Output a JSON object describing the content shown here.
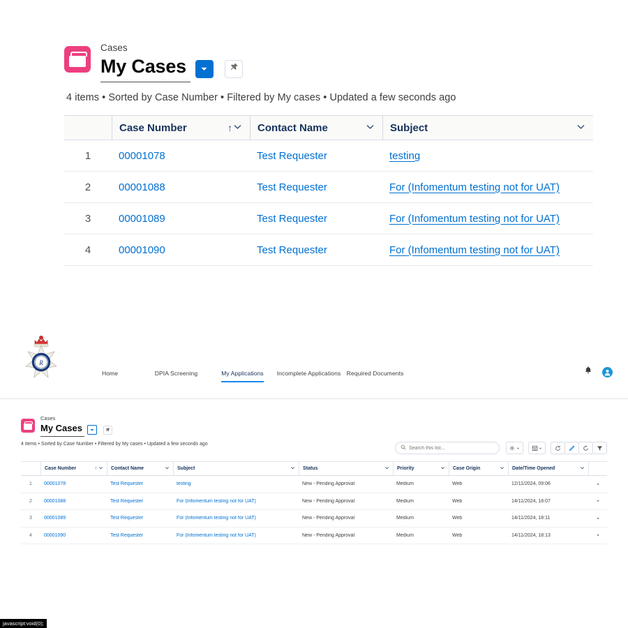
{
  "top": {
    "entity_label": "Cases",
    "view_title": "My Cases",
    "subtitle": "4 items • Sorted by Case Number • Filtered by My cases • Updated a few seconds ago",
    "icons": {
      "entity": "briefcase-icon",
      "view_dropdown": "chevron-down-icon",
      "pin": "pin-icon"
    },
    "columns": [
      "",
      "Case Number",
      "Contact Name",
      "Subject"
    ],
    "sort_indicator": "↑",
    "rows": [
      {
        "num": "1",
        "case_number": "00001078",
        "contact_name": "Test Requester",
        "subject": "testing"
      },
      {
        "num": "2",
        "case_number": "00001088",
        "contact_name": "Test Requester",
        "subject": "For (Infomentum testing not for UAT)"
      },
      {
        "num": "3",
        "case_number": "00001089",
        "contact_name": "Test Requester",
        "subject": "For (Infomentum testing not for UAT)"
      },
      {
        "num": "4",
        "case_number": "00001090",
        "contact_name": "Test Requester",
        "subject": "For (Infomentum testing not for UAT)"
      }
    ]
  },
  "nav": {
    "logo": "police-badge-logo",
    "items": [
      {
        "label": "Home",
        "active": false
      },
      {
        "label": "DPIA Screening",
        "active": false
      },
      {
        "label": "My Applications",
        "active": true
      },
      {
        "label": "Incomplete Applications",
        "active": false
      },
      {
        "label": "Required Documents",
        "active": false
      }
    ],
    "right_icons": [
      {
        "name": "notifications-bell-icon"
      },
      {
        "name": "user-avatar-icon"
      }
    ]
  },
  "lower": {
    "entity_label": "Cases",
    "view_title": "My Cases",
    "subtitle": "4 items • Sorted by Case Number • Filtered by My cases • Updated a few seconds ago",
    "search": {
      "placeholder": "Search this list...",
      "value": ""
    },
    "toolbar_icons": [
      {
        "name": "list-view-controls-icon"
      },
      {
        "name": "display-as-table-icon"
      },
      {
        "name": "refresh-icon"
      },
      {
        "name": "edit-pencil-icon"
      },
      {
        "name": "chart-refresh-icon"
      },
      {
        "name": "filter-icon"
      }
    ],
    "columns": [
      "",
      "Case Number",
      "Contact Name",
      "Subject",
      "Status",
      "Priority",
      "Case Origin",
      "Date/Time Opened",
      ""
    ],
    "sort_indicator": "↑",
    "rows": [
      {
        "num": "1",
        "case_number": "00001078",
        "contact_name": "Test Requester",
        "subject": "testing",
        "status": "New - Pending Approval",
        "priority": "Medium",
        "origin": "Web",
        "opened": "12/11/2024, 09:06"
      },
      {
        "num": "2",
        "case_number": "00001088",
        "contact_name": "Test Requester",
        "subject": "For (Infomentum testing not for UAT)",
        "status": "New - Pending Approval",
        "priority": "Medium",
        "origin": "Web",
        "opened": "14/11/2024, 18:07"
      },
      {
        "num": "3",
        "case_number": "00001089",
        "contact_name": "Test Requester",
        "subject": "For (Infomentum testing not for UAT)",
        "status": "New - Pending Approval",
        "priority": "Medium",
        "origin": "Web",
        "opened": "14/11/2024, 18:11"
      },
      {
        "num": "4",
        "case_number": "00001090",
        "contact_name": "Test Requester",
        "subject": "For (Infomentum testing not for UAT)",
        "status": "New - Pending Approval",
        "priority": "Medium",
        "origin": "Web",
        "opened": "14/11/2024, 18:13"
      }
    ]
  },
  "statusbar": {
    "text": "javascript:void(0);"
  },
  "colors": {
    "accent_pink": "#ED3F7F",
    "link_blue": "#0070d2",
    "nav_active": "#1589ee",
    "text_dark": "#080707",
    "text_muted": "#3e3e3c"
  }
}
